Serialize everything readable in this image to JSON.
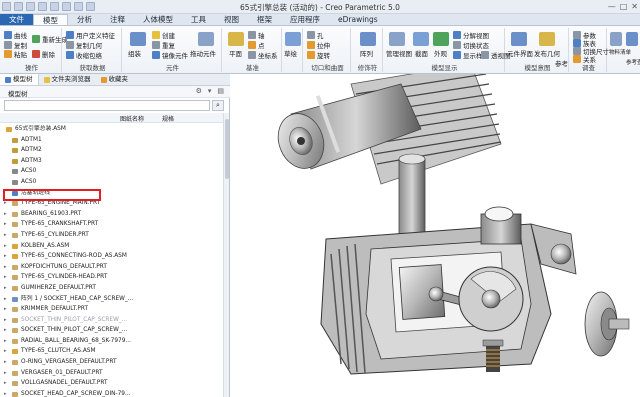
{
  "window": {
    "title": "65式引擎总装 (活动的) - Creo Parametric 5.0",
    "controls": [
      "—",
      "□",
      "✕"
    ]
  },
  "menu": {
    "tabs": [
      "文件",
      "模型",
      "分析",
      "注释",
      "人体模型",
      "工具",
      "视图",
      "框架",
      "应用程序",
      "eDrawings"
    ]
  },
  "ribbon": {
    "groups": [
      {
        "label": "操作",
        "items": [
          "曲线",
          "重新生成",
          "复制",
          "粘贴",
          "删除"
        ]
      },
      {
        "label": "获取数据",
        "items": [
          "用户定义特征",
          "复制几何",
          "收缩包络"
        ]
      },
      {
        "label": "元件",
        "items": [
          "组装",
          "创建",
          "重复",
          "镜像元件",
          "拖动元件"
        ]
      },
      {
        "label": "基准",
        "items": [
          "平面",
          "轴",
          "点",
          "坐标系",
          "草绘"
        ]
      },
      {
        "label": "切口和曲面",
        "items": [
          "孔",
          "拉伸",
          "旋转"
        ]
      },
      {
        "label": "修饰符",
        "items": [
          "阵列"
        ]
      },
      {
        "label": "模型显示",
        "items": [
          "管理视图",
          "截面",
          "外观",
          "分解视图",
          "切换状态",
          "显示样式",
          "透视图"
        ]
      },
      {
        "label": "模型意图",
        "items": [
          "元件界面",
          "发布几何",
          "参考"
        ]
      },
      {
        "label": "调查",
        "items": [
          "参数",
          "族表",
          "切换尺寸",
          "关系"
        ]
      },
      {
        "label": "",
        "items": [
          "物料清单",
          "参考查看器"
        ]
      }
    ]
  },
  "panel": {
    "tabs": [
      "模型树",
      "文件夹浏览器",
      "收藏夹"
    ],
    "tree_label": "模型树",
    "columns": [
      "",
      "图纸名称",
      "规格"
    ],
    "rows": [
      {
        "label": "65式引擎总装.ASM",
        "type": "asm",
        "level": 0
      },
      {
        "label": "ADTM1",
        "type": "plane",
        "level": 1
      },
      {
        "label": "ADTM2",
        "type": "plane",
        "level": 1
      },
      {
        "label": "ADTM3",
        "type": "plane",
        "level": 1
      },
      {
        "label": "ACS0",
        "type": "csys",
        "level": 1
      },
      {
        "label": "ACS0",
        "type": "csys",
        "level": 1
      },
      {
        "label": "活塞轨迹线",
        "type": "sketch",
        "level": 1
      },
      {
        "label": "TYPE-65_ENGINE_MAIN.PRT",
        "type": "prt",
        "level": 1
      },
      {
        "label": "BEARING_61903.PRT",
        "type": "prt",
        "level": 1
      },
      {
        "label": "TYPE-65_CRANKSHAFT.PRT",
        "type": "prt",
        "level": 1
      },
      {
        "label": "TYPE-65_CYLINDER.PRT",
        "type": "prt",
        "level": 1
      },
      {
        "label": "KOLBEN_AS.ASM",
        "type": "asm",
        "level": 1
      },
      {
        "label": "TYPE-65_CONNECTING-ROD_AS.ASM",
        "type": "asm",
        "level": 1
      },
      {
        "label": "KOPFDICHTUNG_DEFAULT.PRT",
        "type": "prt",
        "level": 1
      },
      {
        "label": "TYPE-65_CYLINDER-HEAD.PRT",
        "type": "prt",
        "level": 1
      },
      {
        "label": "GUMIHERZE_DEFAULT.PRT",
        "type": "prt",
        "level": 1
      },
      {
        "label": "阵列 1 / SOCKET_HEAD_CAP_SCREW_...",
        "type": "pattern",
        "level": 1
      },
      {
        "label": "KRIMMER_DEFAULT.PRT",
        "type": "prt",
        "level": 1
      },
      {
        "label": "SOCKET_THIN_PILOT_CAP_SCREW_...",
        "type": "prt",
        "level": 1,
        "faded": true
      },
      {
        "label": "SOCKET_THIN_PILOT_CAP_SCREW_...",
        "type": "prt",
        "level": 1
      },
      {
        "label": "RADIAL_BALL_BEARING_68_SK-7979...",
        "type": "prt",
        "level": 1
      },
      {
        "label": "TYPE-65_CLUTCH_AS.ASM",
        "type": "asm",
        "level": 1
      },
      {
        "label": "O-RING_VERGASER_DEFAULT.PRT",
        "type": "prt",
        "level": 1
      },
      {
        "label": "VERGASER_01_DEFAULT.PRT",
        "type": "prt",
        "level": 1
      },
      {
        "label": "VOLLGASNADEL_DEFAULT.PRT",
        "type": "prt",
        "level": 1
      },
      {
        "label": "SOCKET_HEAD_CAP_SCREW_DIN-79...",
        "type": "prt",
        "level": 1
      }
    ]
  },
  "colors": {
    "accent": "#2c67b3",
    "highlight_box": "#e02020",
    "ribbon_bg": "#eef2f7"
  }
}
